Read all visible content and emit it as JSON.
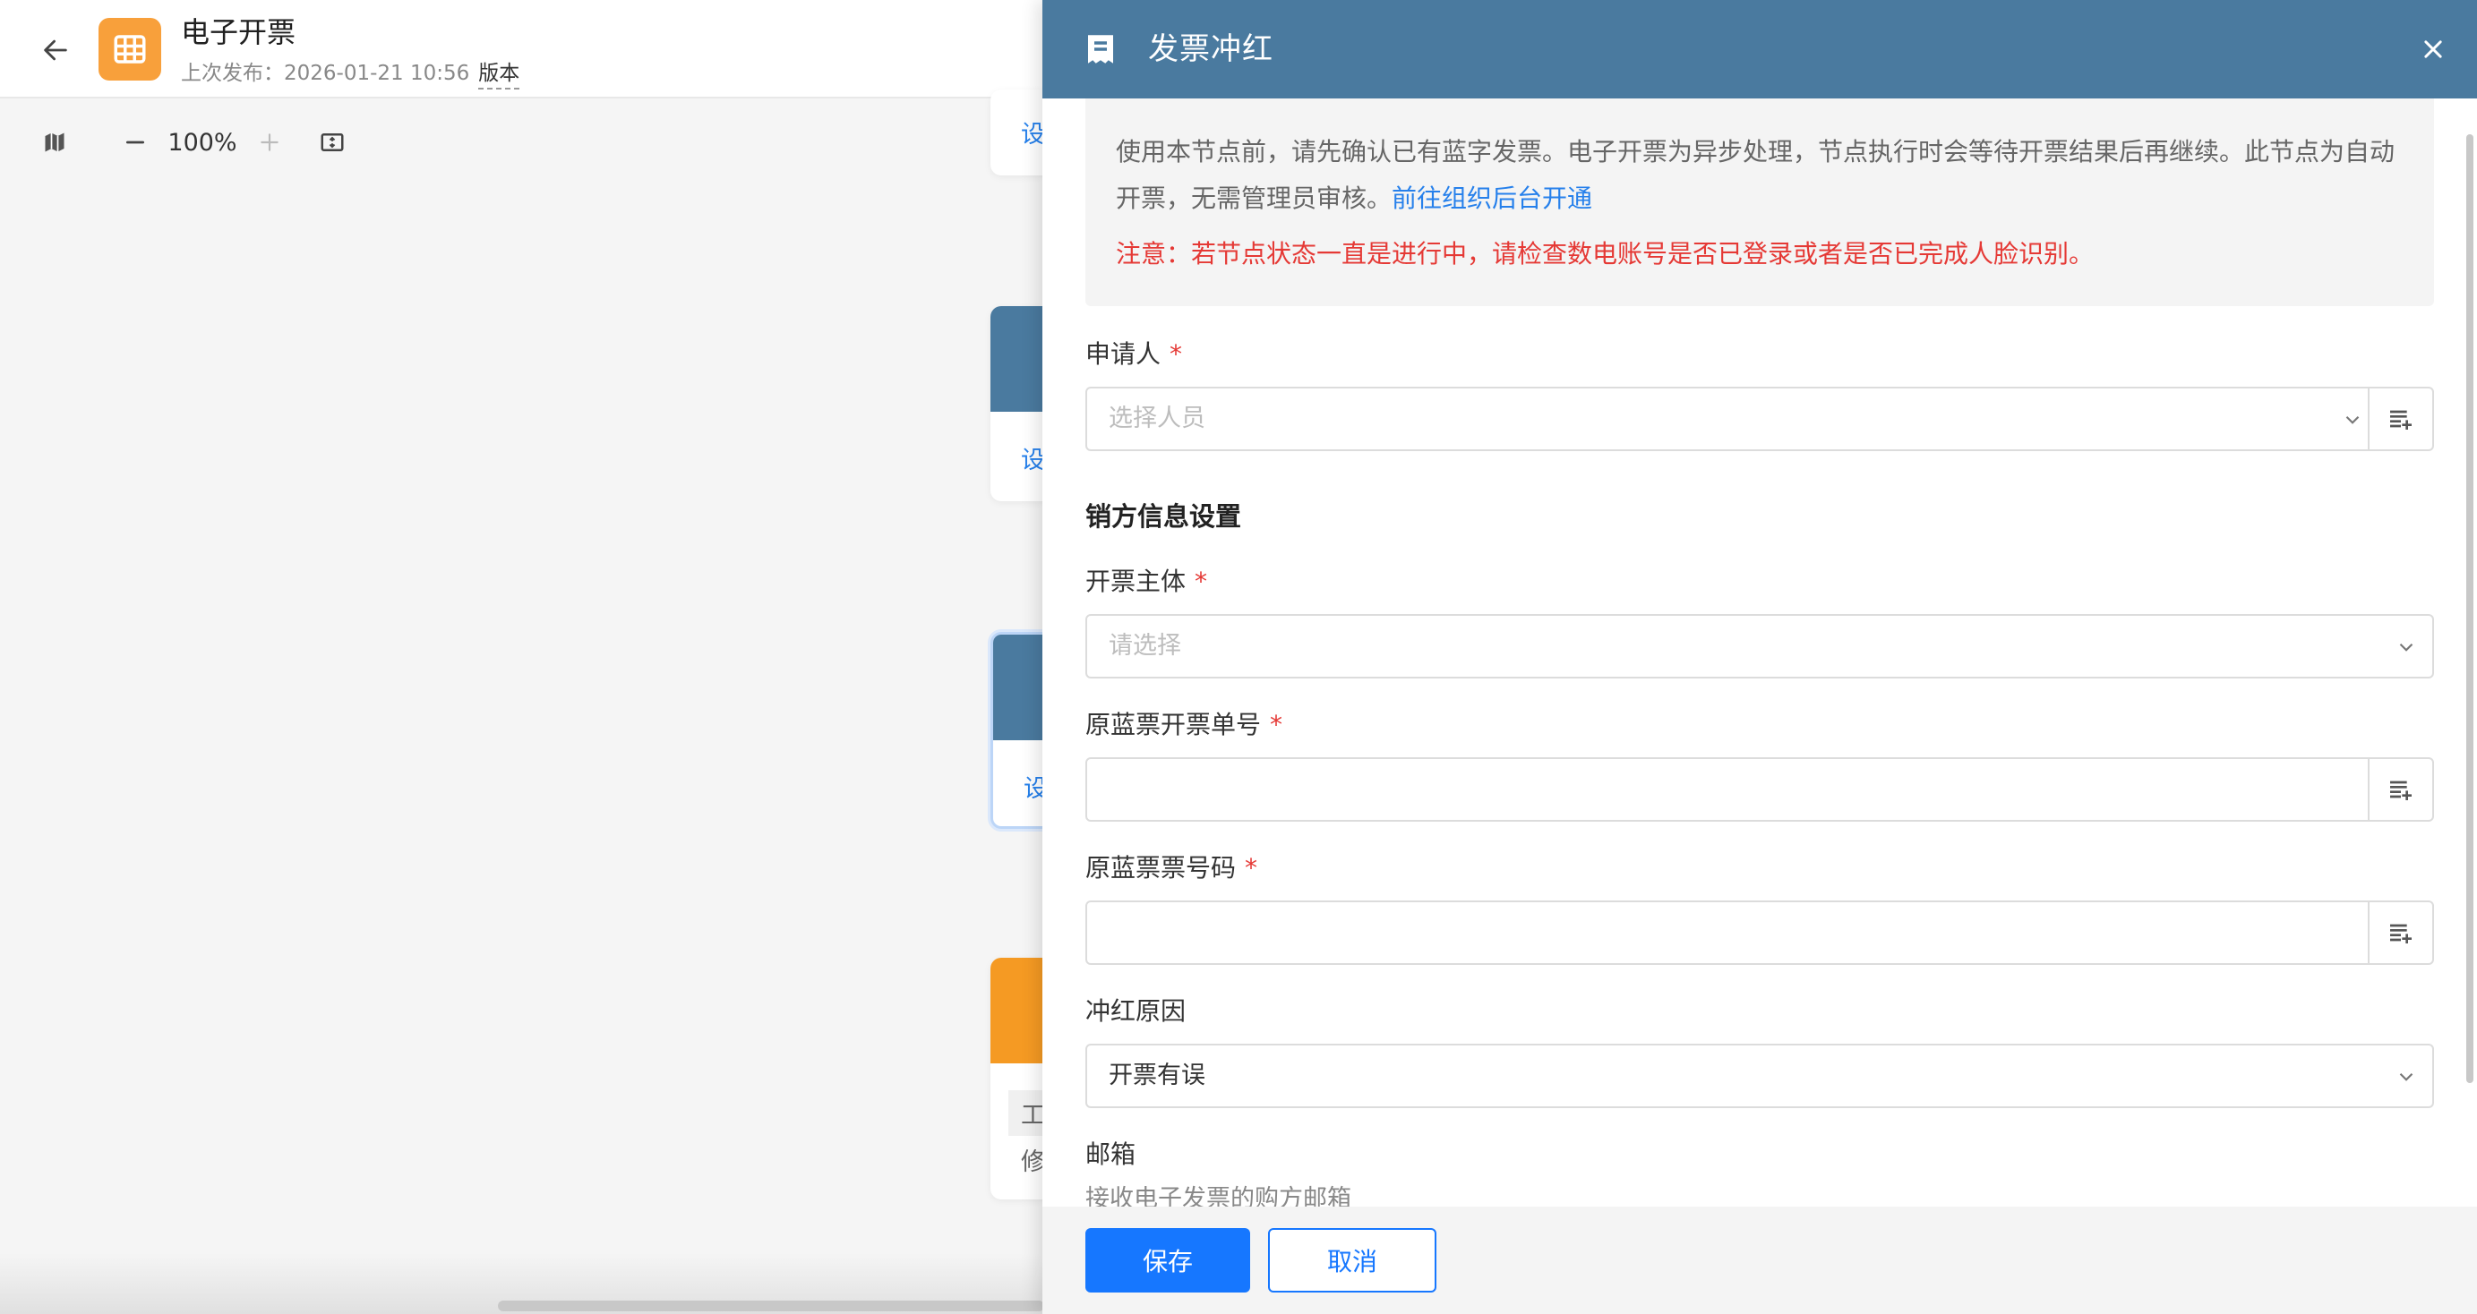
{
  "header": {
    "app_title": "电子开票",
    "last_publish_label": "上次发布：2026-01-21 10:56",
    "version_label": "版本",
    "app_icon": "table-icon",
    "back_icon": "arrow-left-icon"
  },
  "toolbar": {
    "zoom": "100%",
    "map_icon": "map-icon",
    "zoom_out_icon": "minus-icon",
    "zoom_in_icon": "plus-icon",
    "fit_icon": "fit-screen-icon"
  },
  "canvas_nodes": [
    {
      "link": "设"
    },
    {
      "link": "设"
    },
    {
      "link": "设"
    },
    {
      "text1": "工",
      "text2": "修"
    }
  ],
  "drawer": {
    "title": "发票冲红",
    "title_icon": "receipt-icon",
    "close_icon": "close-icon",
    "notice_text": "使用本节点前，请先确认已有蓝字发票。电子开票为异步处理，节点执行时会等待开票结果后再继续。此节点为自动开票，无需管理员审核。",
    "notice_link": "前往组织后台开通",
    "notice_warning": "注意：若节点状态一直是进行中，请检查数电账号是否已登录或者是否已完成人脸识别。",
    "applicant": {
      "label": "申请人",
      "placeholder": "选择人员"
    },
    "seller_section": "销方信息设置",
    "issuer": {
      "label": "开票主体",
      "placeholder": "请选择"
    },
    "orig_order_no": {
      "label": "原蓝票开票单号",
      "value": ""
    },
    "orig_invoice_no": {
      "label": "原蓝票票号码",
      "value": ""
    },
    "reason": {
      "label": "冲红原因",
      "value": "开票有误"
    },
    "email": {
      "label": "邮箱",
      "hint": "接收电子发票的购方邮箱"
    },
    "required_mark": "*",
    "save_label": "保存",
    "cancel_label": "取消"
  },
  "colors": {
    "header_blue": "#4a7a9f",
    "primary": "#1677ff",
    "app_icon_orange": "#f8a03b",
    "warning_red": "#e53935",
    "link_blue": "#2680eb"
  }
}
